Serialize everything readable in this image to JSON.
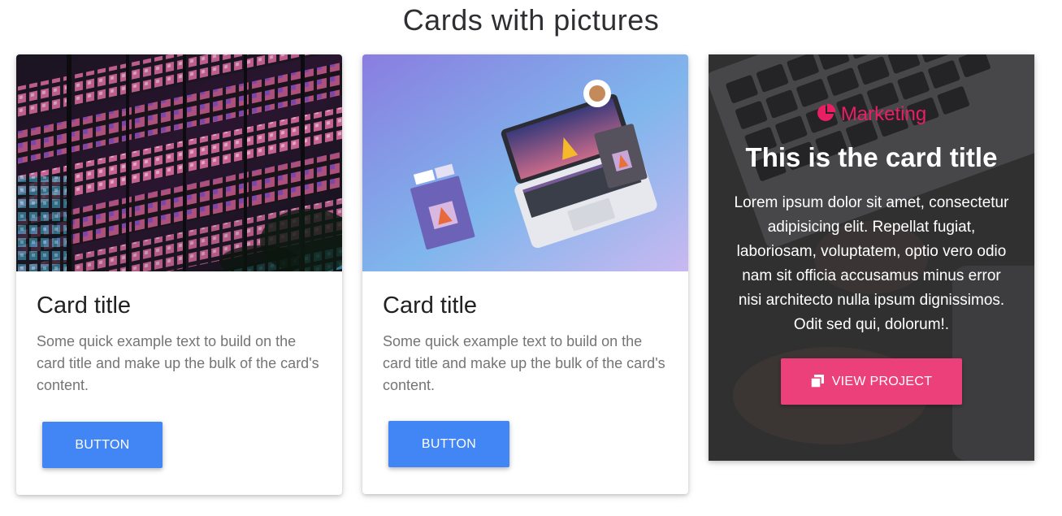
{
  "page": {
    "heading": "Cards with pictures"
  },
  "cards": [
    {
      "title": "Card title",
      "text": "Some quick example text to build on the card title and make up the bulk of the card's content.",
      "button_label": "Button",
      "image_icon": "building-night-photo"
    },
    {
      "title": "Card title",
      "text": "Some quick example text to build on the card title and make up the bulk of the card's content.",
      "button_label": "Button",
      "image_icon": "laptop-mockup-photo"
    }
  ],
  "feature_card": {
    "category_icon": "pie-chart-icon",
    "category": "Marketing",
    "title": "This is the card title",
    "text": "Lorem ipsum dolor sit amet, consectetur adipisicing elit. Repellat fugiat, laboriosam, voluptatem, optio vero odio nam sit officia accusamus minus error nisi architecto nulla ipsum dignissimos. Odit sed qui, dolorum!.",
    "button_icon": "clone-icon",
    "button_label": "VIEW PROJECT"
  },
  "colors": {
    "primary_button": "#4285f4",
    "accent_pink": "#ec407a",
    "category_pink": "#e91e63"
  }
}
